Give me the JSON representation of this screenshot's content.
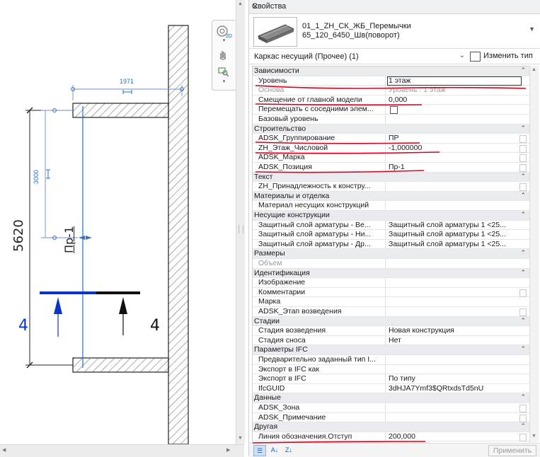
{
  "drawing": {
    "dim_horizontal": "1971",
    "dim_vertical": "3000",
    "dim_total": "5620",
    "lintel_tag": "Пр-1",
    "section_left": "4",
    "section_right": "4"
  },
  "panel": {
    "title": "Свойства",
    "close": "✕",
    "type_line1": "01_1_ZH_СК_ЖБ_Перемычки",
    "type_line2": "65_120_6450_Шв(поворот)",
    "filter": "Каркас несущий (Прочее) (1)",
    "edit_type": "Изменить тип",
    "apply": "Применить"
  },
  "rows": [
    {
      "kind": "cat",
      "name": "Зависимости"
    },
    {
      "kind": "input",
      "name": "Уровень",
      "value": "1 этаж"
    },
    {
      "kind": "dim",
      "name": "Основа",
      "value": "Уровень : 1 этаж"
    },
    {
      "kind": "prop",
      "name": "Смещение от главной модели",
      "value": "0,000"
    },
    {
      "kind": "check",
      "name": "Перемещать с соседними элем...",
      "value": ""
    },
    {
      "kind": "prop",
      "name": "Базовый уровень",
      "value": ""
    },
    {
      "kind": "cat",
      "name": "Строительство"
    },
    {
      "kind": "prop",
      "name": "ADSK_Группирование",
      "value": "ПР",
      "box": true
    },
    {
      "kind": "prop",
      "name": "ZH_Этаж_Числовой",
      "value": "-1,000000",
      "box": true
    },
    {
      "kind": "prop",
      "name": "ADSK_Марка",
      "value": "",
      "box": true
    },
    {
      "kind": "prop",
      "name": "ADSK_Позиция",
      "value": "Пр-1",
      "box": true
    },
    {
      "kind": "cat",
      "name": "Текст"
    },
    {
      "kind": "prop",
      "name": "ZH_Принадлежность к констру...",
      "value": "",
      "box": true
    },
    {
      "kind": "cat",
      "name": "Материалы и отделка"
    },
    {
      "kind": "prop",
      "name": "Материал несущих конструкций",
      "value": ""
    },
    {
      "kind": "cat",
      "name": "Несущие конструкции"
    },
    {
      "kind": "prop",
      "name": "Защитный слой арматуры - Ве...",
      "value": "Защитный слой арматуры 1 <25..."
    },
    {
      "kind": "prop",
      "name": "Защитный слой арматуры - Ни...",
      "value": "Защитный слой арматуры 1 <25..."
    },
    {
      "kind": "prop",
      "name": "Защитный слой арматуры - Др...",
      "value": "Защитный слой арматуры 1 <25..."
    },
    {
      "kind": "cat",
      "name": "Размеры"
    },
    {
      "kind": "dim",
      "name": "Объем",
      "value": ""
    },
    {
      "kind": "cat",
      "name": "Идентификация"
    },
    {
      "kind": "prop",
      "name": "Изображение",
      "value": ""
    },
    {
      "kind": "prop",
      "name": "Комментарии",
      "value": "",
      "box": true
    },
    {
      "kind": "prop",
      "name": "Марка",
      "value": ""
    },
    {
      "kind": "prop",
      "name": "ADSK_Этап возведения",
      "value": "",
      "box": true
    },
    {
      "kind": "cat",
      "name": "Стадии"
    },
    {
      "kind": "prop",
      "name": "Стадия возведения",
      "value": "Новая конструкция"
    },
    {
      "kind": "prop",
      "name": "Стадия сноса",
      "value": "Нет"
    },
    {
      "kind": "cat",
      "name": "Параметры IFC"
    },
    {
      "kind": "prop",
      "name": "Предварительно заданный тип I...",
      "value": ""
    },
    {
      "kind": "prop",
      "name": "Экспорт в IFC как",
      "value": ""
    },
    {
      "kind": "prop",
      "name": "Экспорт в IFC",
      "value": "По типу"
    },
    {
      "kind": "prop",
      "name": "IfcGUID",
      "value": "3dHJA7Ymf3$QRtxdsTd5nU"
    },
    {
      "kind": "cat",
      "name": "Данные"
    },
    {
      "kind": "prop",
      "name": "ADSK_Зона",
      "value": "",
      "box": true
    },
    {
      "kind": "prop",
      "name": "ADSK_Примечание",
      "value": "",
      "box": true
    },
    {
      "kind": "cat",
      "name": "Другая"
    },
    {
      "kind": "prop",
      "name": "Линия обозначения.Отступ",
      "value": "200,000",
      "box": true
    }
  ],
  "icons": [
    "steering-wheel-icon",
    "pan-hand-icon",
    "zoom-region-icon",
    "edit-type-icon",
    "sort-category-icon",
    "sort-az-icon",
    "sort-za-icon"
  ],
  "colors": {
    "annotation_red": "#e0001b",
    "dim_blue": "#1f6fd0",
    "section_blue": "#0a35c8",
    "panel_category": "#e9ebef"
  }
}
